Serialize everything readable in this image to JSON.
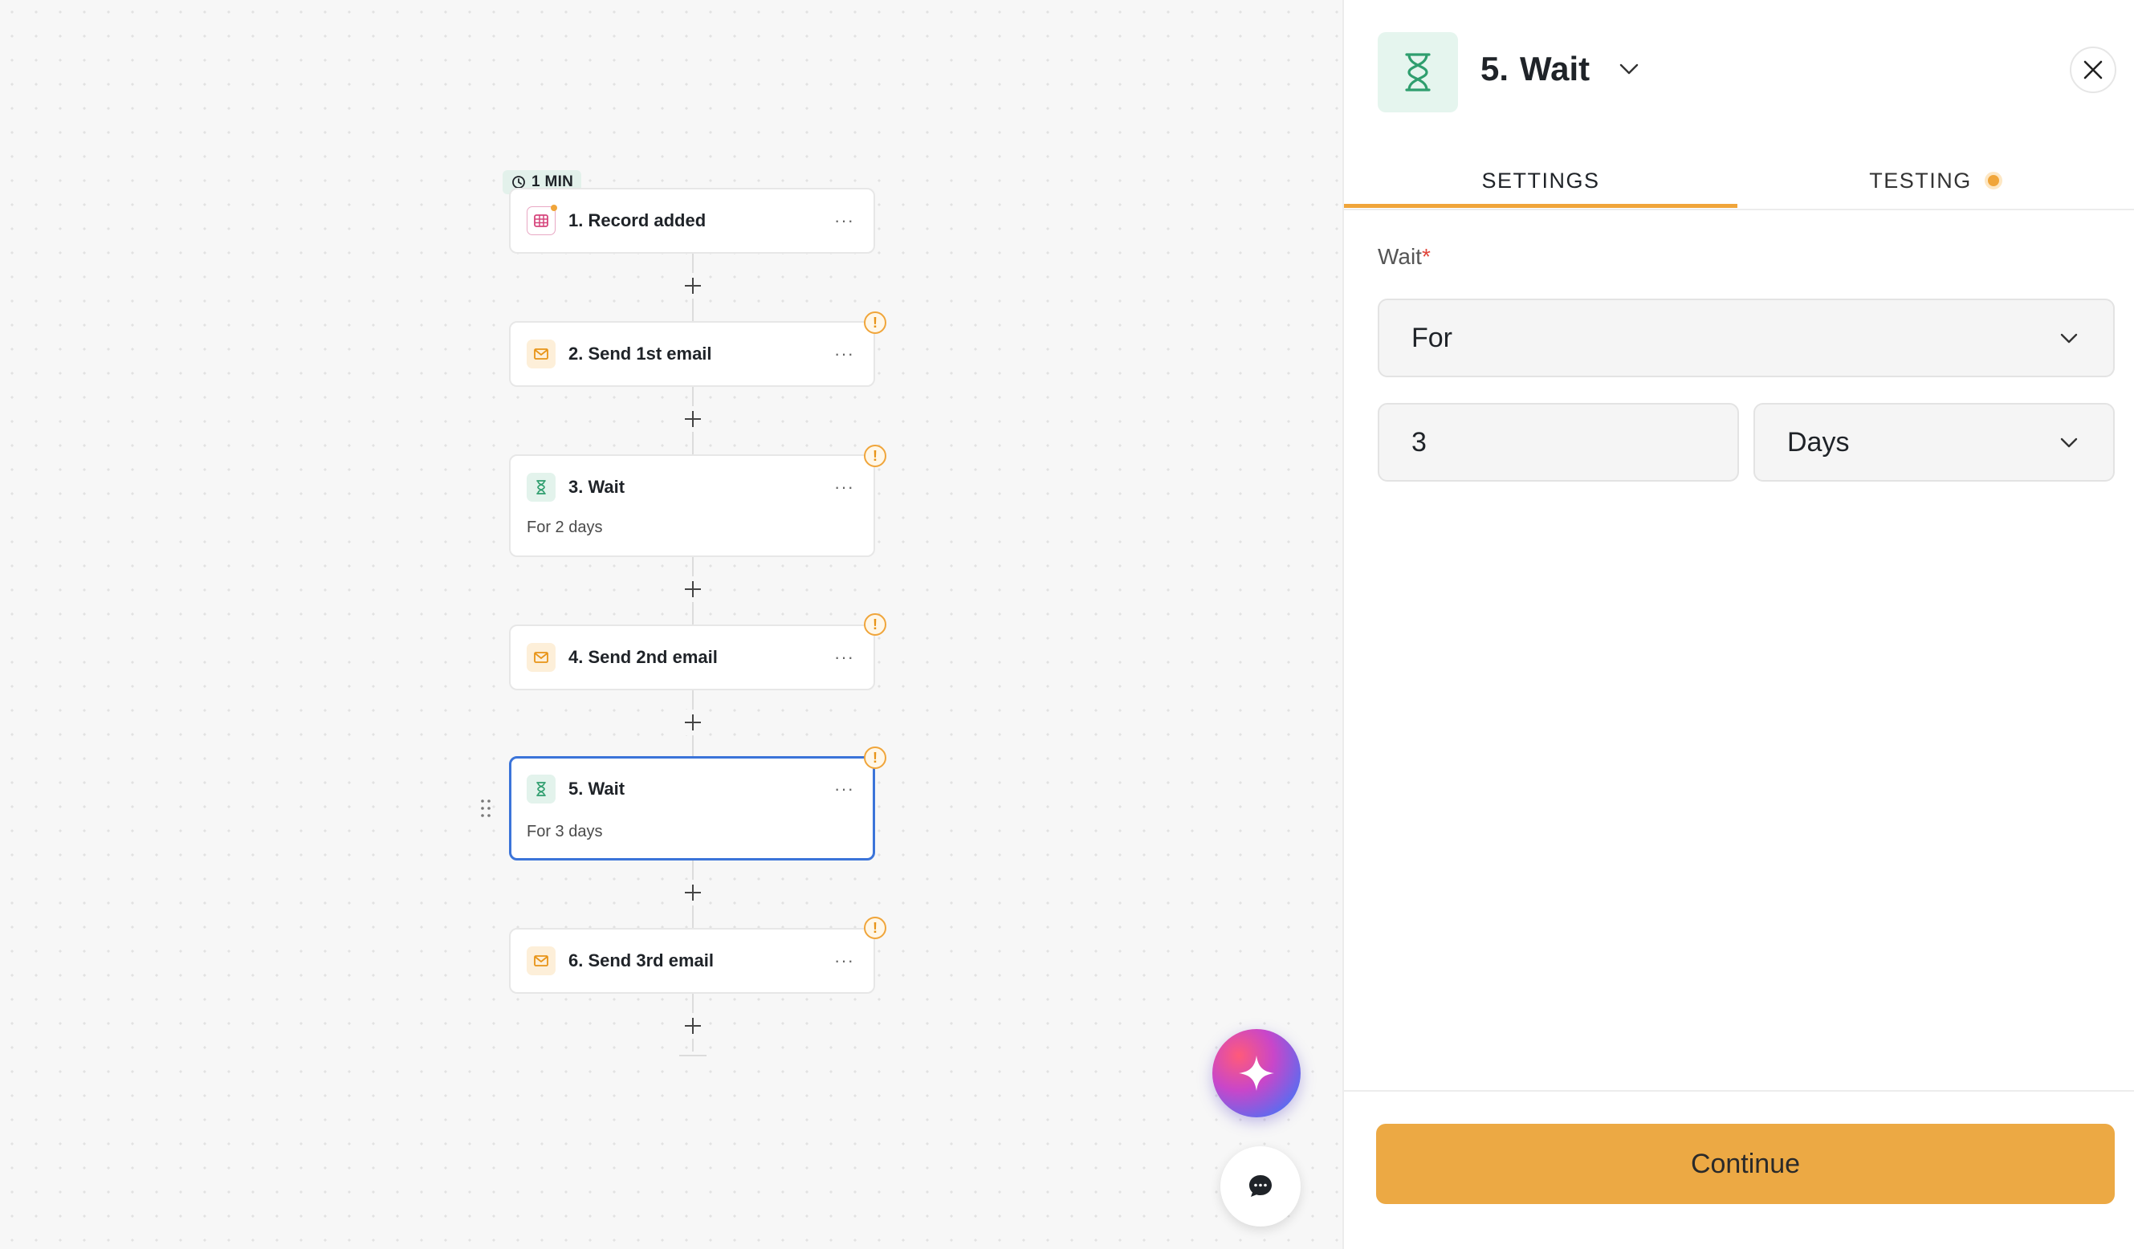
{
  "canvas": {
    "trigger_badge": "1 MIN",
    "steps": [
      {
        "title": "1. Record added",
        "subtitle": "",
        "icon": "table-icon",
        "menu": "···"
      },
      {
        "title": "2. Send 1st email",
        "subtitle": "",
        "icon": "mail-icon",
        "menu": "···"
      },
      {
        "title": "3. Wait",
        "subtitle": "For 2 days",
        "icon": "hourglass-icon",
        "menu": "···"
      },
      {
        "title": "4. Send 2nd email",
        "subtitle": "",
        "icon": "mail-icon",
        "menu": "···"
      },
      {
        "title": "5. Wait",
        "subtitle": "For 3 days",
        "icon": "hourglass-icon",
        "menu": "···"
      },
      {
        "title": "6. Send 3rd email",
        "subtitle": "",
        "icon": "mail-icon",
        "menu": "···"
      }
    ],
    "warning_glyph": "!"
  },
  "panel": {
    "title_number": "5.",
    "title": "Wait",
    "tabs": [
      {
        "label": "SETTINGS",
        "active": true
      },
      {
        "label": "TESTING",
        "active": false
      }
    ],
    "wait_label": "Wait",
    "required_mark": "*",
    "wait_mode": "For",
    "amount": "3",
    "unit": "Days",
    "continue_label": "Continue"
  },
  "colors": {
    "accent": "#eca944",
    "selected_border": "#3b74d9",
    "warning": "#f0a53a",
    "wait_icon": "#2f9e6e",
    "mail_icon": "#e89417"
  }
}
